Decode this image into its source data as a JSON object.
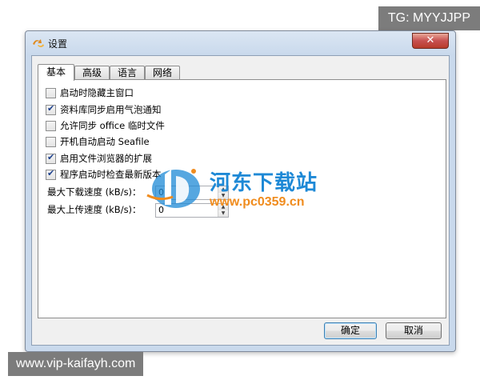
{
  "overlay": {
    "top_right_tag": "TG: MYYJJPP",
    "bottom_left_tag": "www.vip-kaifayh.com",
    "watermark_title": "河东下载站",
    "watermark_url": "www.pc0359.cn"
  },
  "window": {
    "title": "设置",
    "icon": "seafile-app-icon",
    "close_glyph": "✕"
  },
  "tabs": [
    {
      "label": "基本",
      "active": true
    },
    {
      "label": "高级",
      "active": false
    },
    {
      "label": "语言",
      "active": false
    },
    {
      "label": "网络",
      "active": false
    }
  ],
  "options": [
    {
      "label": "启动时隐藏主窗口",
      "checked": false
    },
    {
      "label": "资料库同步启用气泡通知",
      "checked": true
    },
    {
      "label": "允许同步 office 临时文件",
      "checked": false
    },
    {
      "label": "开机自动启动 Seafile",
      "checked": false
    },
    {
      "label": "启用文件浏览器的扩展",
      "checked": true
    },
    {
      "label": "程序启动时检查最新版本",
      "checked": true
    }
  ],
  "speed": {
    "download_label": "最大下载速度 (kB/s)：",
    "download_value": "0",
    "upload_label": "最大上传速度 (kB/s)：",
    "upload_value": "0"
  },
  "buttons": {
    "ok": "确定",
    "cancel": "取消"
  },
  "colors": {
    "check_mark": "#1b3f8c",
    "watermark_blue": "#1e89d6",
    "watermark_orange": "#f08c1e"
  }
}
